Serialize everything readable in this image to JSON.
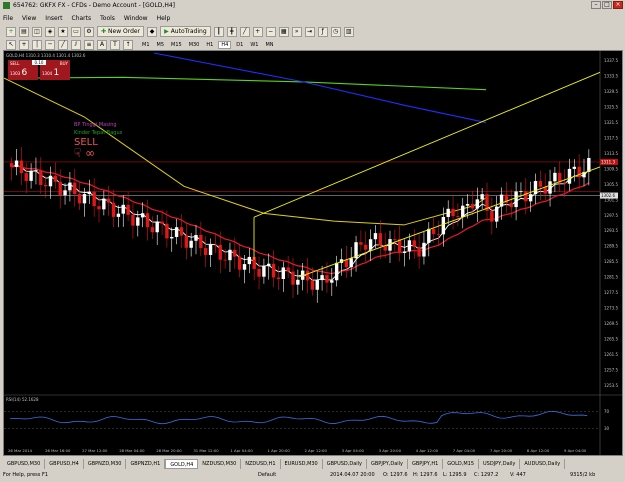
{
  "window": {
    "title": "654762: GKFX FX - CFDs - Demo Account - [GOLD,H4]"
  },
  "menu": [
    "File",
    "View",
    "Insert",
    "Charts",
    "Tools",
    "Window",
    "Help"
  ],
  "toolbar": {
    "new_order": "New Order",
    "autotrading": "AutoTrading",
    "timeframes": [
      "M1",
      "M5",
      "M15",
      "M30",
      "H1",
      "H4",
      "D1",
      "W1",
      "MN"
    ]
  },
  "chart": {
    "symbol_label": "GOLD,H4  1310.3 1310.4 1301.4 1302.6",
    "trade_panel": {
      "sell": "SELL",
      "buy": "BUY",
      "lot": "0.10",
      "sell_price_a": "1303",
      "sell_price_b": "6",
      "buy_price_a": "1304",
      "buy_price_b": "1"
    },
    "signal_line1": "BP Tinggi Masing",
    "signal_line2": "Kinder Tepat Bagus",
    "signal_sell": "SELL",
    "rsi_label": "RSI(14) 52.1628",
    "colors": {
      "bull": "#ffffff",
      "bear": "#e01818",
      "ema_white": "#ffffff",
      "ema_red": "#e61a2a",
      "ema_yellow": "#e0d010",
      "ema_green": "#5ad21e",
      "ema_blue": "#1e2fff",
      "channel": "#f0f010",
      "rsi": "#3c6ee0"
    }
  },
  "chart_data": {
    "type": "candlestick",
    "price_ticks": [
      "1337.5",
      "1333.5",
      "1329.5",
      "1325.5",
      "1321.5",
      "1317.5",
      "1313.5",
      "1309.5",
      "1305.5",
      "1301.5",
      "1297.5",
      "1293.5",
      "1289.5",
      "1285.5",
      "1281.5",
      "1277.5",
      "1273.5",
      "1269.5",
      "1265.5",
      "1261.5",
      "1257.5",
      "1253.5"
    ],
    "price_tag_red": "1311.3",
    "price_tag_current": "1302.6",
    "time_ticks": [
      "26 Mar 2014",
      "26 Mar 16:00",
      "27 Mar 12:00",
      "28 Mar 04:00",
      "28 Mar 20:00",
      "31 Mar 12:00",
      "1 Apr 04:00",
      "1 Apr 20:00",
      "2 Apr 12:00",
      "3 Apr 04:00",
      "3 Apr 20:00",
      "4 Apr 12:00",
      "7 Apr 04:00",
      "7 Apr 20:00",
      "8 Apr 12:00",
      "9 Apr 04:00"
    ],
    "rsi_ticks": [
      "70",
      "30"
    ]
  },
  "tabs": [
    "GBPUSD,M30",
    "GBPUSD,H4",
    "GBPNZD,M30",
    "GBPNZD,H1",
    "GOLD,H4",
    "NZDUSD,M30",
    "NZDUSD,H1",
    "EURUSD,M30",
    "GBPUSD,Daily",
    "GBPJPY,Daily",
    "GBPJPY,H1",
    "GOLD,M15",
    "USDJPY,Daily",
    "AUDUSD,Daily"
  ],
  "active_tab": 4,
  "status": {
    "help": "For Help, press F1",
    "profile": "Default",
    "datetime": "2014.04.07 20:00",
    "open": "O: 1297.6",
    "high": "H: 1297.6",
    "low": "L: 1295.9",
    "close": "C: 1297.2",
    "volume": "V: 447",
    "traffic": "9315/2 kb"
  }
}
